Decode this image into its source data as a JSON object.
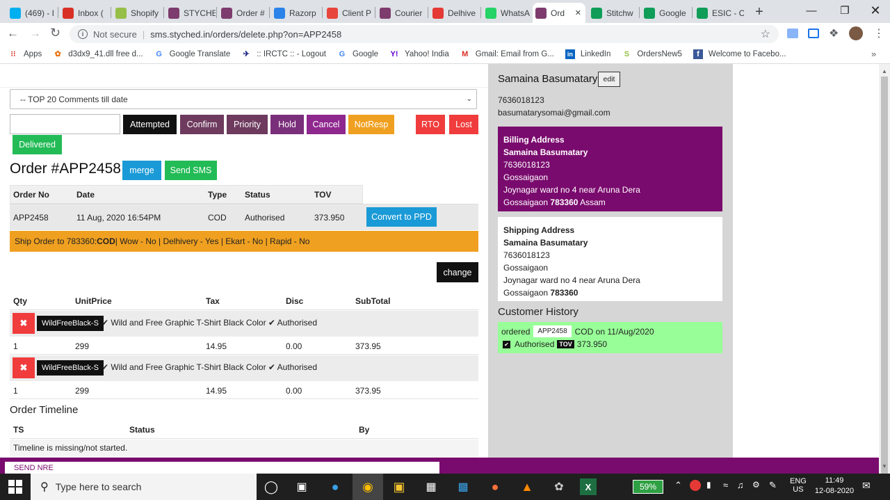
{
  "browser": {
    "tabs": [
      {
        "label": "(469) - I",
        "icon": "skype-icon",
        "color": "#00aff0"
      },
      {
        "label": "Inbox (",
        "icon": "gmail-icon",
        "color": "#d93025"
      },
      {
        "label": "Shopify",
        "icon": "shopify-icon",
        "color": "#95bf47"
      },
      {
        "label": "STYCHE",
        "icon": "stytched-icon",
        "color": "#7d3c6d"
      },
      {
        "label": "Order #",
        "icon": "stytched-icon",
        "color": "#7d3c6d"
      },
      {
        "label": "Razorp",
        "icon": "razorpay-icon",
        "color": "#2b83ea"
      },
      {
        "label": "Client P",
        "icon": "client-icon",
        "color": "#e8453c"
      },
      {
        "label": "Courier",
        "icon": "stytched-icon",
        "color": "#7d3c6d"
      },
      {
        "label": "Delhive",
        "icon": "delhivery-icon",
        "color": "#e53935"
      },
      {
        "label": "WhatsA",
        "icon": "whatsapp-icon",
        "color": "#25d366"
      },
      {
        "label": "Ord",
        "icon": "stytched-icon",
        "color": "#7d3c6d"
      },
      {
        "label": "Stitchw",
        "icon": "sheets-icon",
        "color": "#0f9d58"
      },
      {
        "label": "Google",
        "icon": "sheets-icon",
        "color": "#0f9d58"
      },
      {
        "label": "ESIC - C",
        "icon": "sheets-icon",
        "color": "#0f9d58"
      }
    ],
    "new_tab": "+",
    "not_secure": "Not secure",
    "url": "sms.styched.in/orders/delete.php?on=APP2458",
    "bookmarks": [
      {
        "label": "Apps",
        "icon": "apps-icon",
        "color": "#d93025"
      },
      {
        "label": "d3dx9_41.dll free d...",
        "icon": "gear-icon",
        "color": "#e8710a"
      },
      {
        "label": "Google Translate",
        "icon": "translate-icon",
        "color": "#4285f4"
      },
      {
        "label": ":: IRCTC :: - Logout",
        "icon": "irctc-icon",
        "color": "#1a237e"
      },
      {
        "label": "Google",
        "icon": "google-icon",
        "color": "#4285f4"
      },
      {
        "label": "Yahoo! India",
        "icon": "yahoo-icon",
        "color": "#6001d2"
      },
      {
        "label": "Gmail: Email from G...",
        "icon": "gmail-icon",
        "color": "#d93025"
      },
      {
        "label": "LinkedIn",
        "icon": "linkedin-icon",
        "color": "#0a66c2"
      },
      {
        "label": "OrdersNew5",
        "icon": "shopify-icon",
        "color": "#95bf47"
      },
      {
        "label": "Welcome to Facebo...",
        "icon": "facebook-icon",
        "color": "#3b5998"
      }
    ]
  },
  "page": {
    "comments_select": "-- TOP 20 Comments till date",
    "status_buttons": [
      {
        "label": "Attempted",
        "color": "#111111"
      },
      {
        "label": "Confirm",
        "color": "#6e3a5e"
      },
      {
        "label": "Priority",
        "color": "#6e3a5e"
      },
      {
        "label": "Hold",
        "color": "#7a2f7a"
      },
      {
        "label": "Cancel",
        "color": "#8e278e"
      },
      {
        "label": "NotResp",
        "color": "#f0a020"
      },
      {
        "label": "RTO",
        "color": "#f03c3c"
      },
      {
        "label": "Lost",
        "color": "#f03c3c"
      },
      {
        "label": "Delivered",
        "color": "#22bb55"
      }
    ],
    "order_title": "Order #APP2458",
    "merge": "merge",
    "send_sms": "Send SMS",
    "order_headers": [
      "Order No",
      "Date",
      "Type",
      "Status",
      "TOV"
    ],
    "order_row": [
      "APP2458",
      "11 Aug, 2020 16:54PM",
      "COD",
      "Authorised",
      "373.950"
    ],
    "convert": "Convert to PPD",
    "ship_prefix": "Ship Order to 783360: ",
    "ship_cod": "COD",
    "ship_rest": " | Wow - No | Delhivery - Yes | Ekart - No | Rapid - No",
    "change": "change",
    "item_headers": [
      "Qty",
      "UnitPrice",
      "Tax",
      "Disc",
      "SubTotal"
    ],
    "items": [
      {
        "sku": "WildFreeBlack-S",
        "desc": "✔ Wild and Free Graphic T-Shirt Black Color ✔ Authorised",
        "qty": "1",
        "price": "299",
        "tax": "14.95",
        "disc": "0.00",
        "subtotal": "373.95"
      },
      {
        "sku": "WildFreeBlack-S",
        "desc": "✔ Wild and Free Graphic T-Shirt Black Color ✔ Authorised",
        "qty": "1",
        "price": "299",
        "tax": "14.95",
        "disc": "0.00",
        "subtotal": "373.95"
      }
    ],
    "timeline_title": "Order Timeline",
    "timeline_headers": [
      "TS",
      "Status",
      "By"
    ],
    "timeline_empty": "Timeline is missing/not started.",
    "send_nre": "SEND NRE"
  },
  "customer": {
    "name": "Samaina Basumatary",
    "edit": "edit",
    "phone": "7636018123",
    "email": "basumatarysomai@gmail.com",
    "billing": {
      "title": "Billing Address",
      "name": "Samaina Basumatary",
      "phone": "7636018123",
      "city": "Gossaigaon",
      "line": "Joynagar ward no 4 near Aruna Dera",
      "city2": "Gossaigaon",
      "pin": "783360",
      "state": "Assam"
    },
    "shipping": {
      "title": "Shipping Address",
      "name": "Samaina Basumatary",
      "phone": "7636018123",
      "city": "Gossaigaon",
      "line": "Joynagar ward no 4 near Aruna Dera",
      "city2": "Gossaigaon",
      "pin": "783360"
    },
    "history_title": "Customer History",
    "history": {
      "ordered": "ordered",
      "order_no": "APP2458",
      "on": "COD on 11/Aug/2020",
      "status": "Authorised",
      "tov_badge": "TOV",
      "tov": "373.950"
    }
  },
  "taskbar": {
    "search_placeholder": "Type here to search",
    "battery": "59%",
    "lang1": "ENG",
    "lang2": "US",
    "time": "11:49",
    "date": "12-08-2020"
  }
}
